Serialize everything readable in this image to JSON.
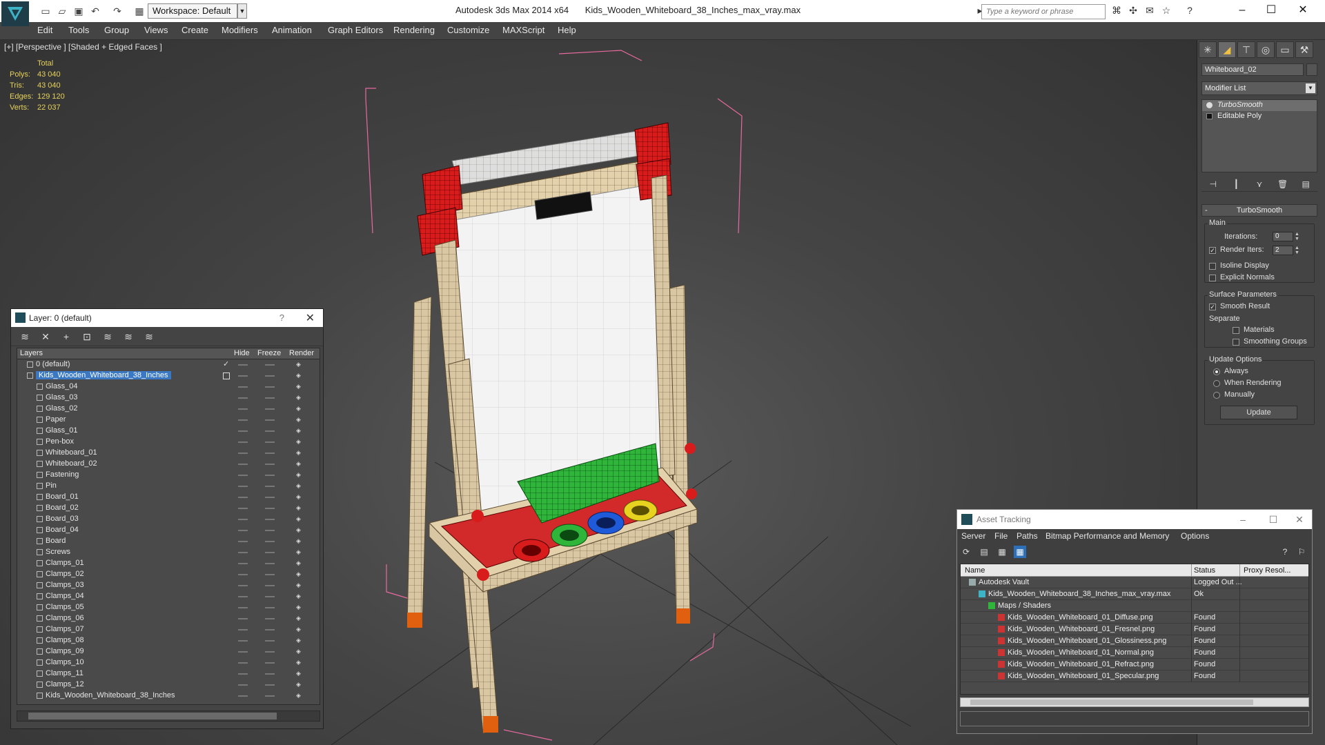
{
  "titlebar": {
    "workspace": "Workspace: Default",
    "app_name": "Autodesk 3ds Max  2014 x64",
    "file_name": "Kids_Wooden_Whiteboard_38_Inches_max_vray.max",
    "search_placeholder": "Type a keyword or phrase"
  },
  "menu": [
    "Edit",
    "Tools",
    "Group",
    "Views",
    "Create",
    "Modifiers",
    "Animation",
    "Graph Editors",
    "Rendering",
    "Customize",
    "MAXScript",
    "Help"
  ],
  "viewport": {
    "label": "[+] [Perspective ] [Shaded + Edged Faces ]",
    "stats": {
      "header": "Total",
      "rows": [
        {
          "k": "Polys:",
          "v": "43 040"
        },
        {
          "k": "Tris:",
          "v": "43 040"
        },
        {
          "k": "Edges:",
          "v": "129 120"
        },
        {
          "k": "Verts:",
          "v": "22 037"
        }
      ]
    }
  },
  "command_panel": {
    "object_name": "Whiteboard_02",
    "modifier_list": "Modifier List",
    "stack": [
      "TurboSmooth",
      "Editable Poly"
    ],
    "rollout": "TurboSmooth",
    "main_group": "Main",
    "iterations_label": "Iterations:",
    "iterations_value": "0",
    "render_iters_label": "Render Iters:",
    "render_iters_value": "2",
    "isoline": "Isoline Display",
    "explicit_normals": "Explicit Normals",
    "surface_group": "Surface Parameters",
    "smooth_result": "Smooth Result",
    "separate": "Separate",
    "materials": "Materials",
    "smoothing_groups": "Smoothing Groups",
    "update_group": "Update Options",
    "always": "Always",
    "when_rendering": "When Rendering",
    "manually": "Manually",
    "update_button": "Update"
  },
  "layer_window": {
    "title": "Layer: 0 (default)",
    "columns": {
      "layers": "Layers",
      "hide": "Hide",
      "freeze": "Freeze",
      "render": "Render"
    },
    "rows": [
      {
        "name": "0 (default)",
        "level": 1
      },
      {
        "name": "Kids_Wooden_Whiteboard_38_Inches",
        "level": 1
      },
      {
        "name": "Glass_04",
        "level": 2
      },
      {
        "name": "Glass_03",
        "level": 2
      },
      {
        "name": "Glass_02",
        "level": 2
      },
      {
        "name": "Paper",
        "level": 2
      },
      {
        "name": "Glass_01",
        "level": 2
      },
      {
        "name": "Pen-box",
        "level": 2
      },
      {
        "name": "Whiteboard_01",
        "level": 2
      },
      {
        "name": "Whiteboard_02",
        "level": 2
      },
      {
        "name": "Fastening",
        "level": 2
      },
      {
        "name": "Pin",
        "level": 2
      },
      {
        "name": "Board_01",
        "level": 2
      },
      {
        "name": "Board_02",
        "level": 2
      },
      {
        "name": "Board_03",
        "level": 2
      },
      {
        "name": "Board_04",
        "level": 2
      },
      {
        "name": "Board",
        "level": 2
      },
      {
        "name": "Screws",
        "level": 2
      },
      {
        "name": "Clamps_01",
        "level": 2
      },
      {
        "name": "Clamps_02",
        "level": 2
      },
      {
        "name": "Clamps_03",
        "level": 2
      },
      {
        "name": "Clamps_04",
        "level": 2
      },
      {
        "name": "Clamps_05",
        "level": 2
      },
      {
        "name": "Clamps_06",
        "level": 2
      },
      {
        "name": "Clamps_07",
        "level": 2
      },
      {
        "name": "Clamps_08",
        "level": 2
      },
      {
        "name": "Clamps_09",
        "level": 2
      },
      {
        "name": "Clamps_10",
        "level": 2
      },
      {
        "name": "Clamps_11",
        "level": 2
      },
      {
        "name": "Clamps_12",
        "level": 2
      },
      {
        "name": "Kids_Wooden_Whiteboard_38_Inches",
        "level": 2
      }
    ]
  },
  "asset_window": {
    "title": "Asset Tracking",
    "menu": [
      "Server",
      "File",
      "Paths",
      "Bitmap Performance and Memory",
      "Options"
    ],
    "columns": {
      "name": "Name",
      "status": "Status",
      "proxy": "Proxy Resol..."
    },
    "rows": [
      {
        "name": "Autodesk Vault",
        "status": "Logged Out ...",
        "level": 1,
        "icon": "vault-icon"
      },
      {
        "name": "Kids_Wooden_Whiteboard_38_Inches_max_vray.max",
        "status": "Ok",
        "level": 2,
        "icon": "max-file-icon"
      },
      {
        "name": "Maps / Shaders",
        "status": "",
        "level": 3,
        "icon": "maps-icon"
      },
      {
        "name": "Kids_Wooden_Whiteboard_01_Diffuse.png",
        "status": "Found",
        "level": 4,
        "icon": "png-icon"
      },
      {
        "name": "Kids_Wooden_Whiteboard_01_Fresnel.png",
        "status": "Found",
        "level": 4,
        "icon": "png-icon"
      },
      {
        "name": "Kids_Wooden_Whiteboard_01_Glossiness.png",
        "status": "Found",
        "level": 4,
        "icon": "png-icon"
      },
      {
        "name": "Kids_Wooden_Whiteboard_01_Normal.png",
        "status": "Found",
        "level": 4,
        "icon": "png-icon"
      },
      {
        "name": "Kids_Wooden_Whiteboard_01_Refract.png",
        "status": "Found",
        "level": 4,
        "icon": "png-icon"
      },
      {
        "name": "Kids_Wooden_Whiteboard_01_Specular.png",
        "status": "Found",
        "level": 4,
        "icon": "png-icon"
      }
    ]
  },
  "colors": {
    "stats_text": "#e7d25a",
    "selection": "#3a78c4",
    "wood": "#d9c6a2",
    "clamp_red": "#d81c1c",
    "tray_green": "#2fb53a"
  }
}
